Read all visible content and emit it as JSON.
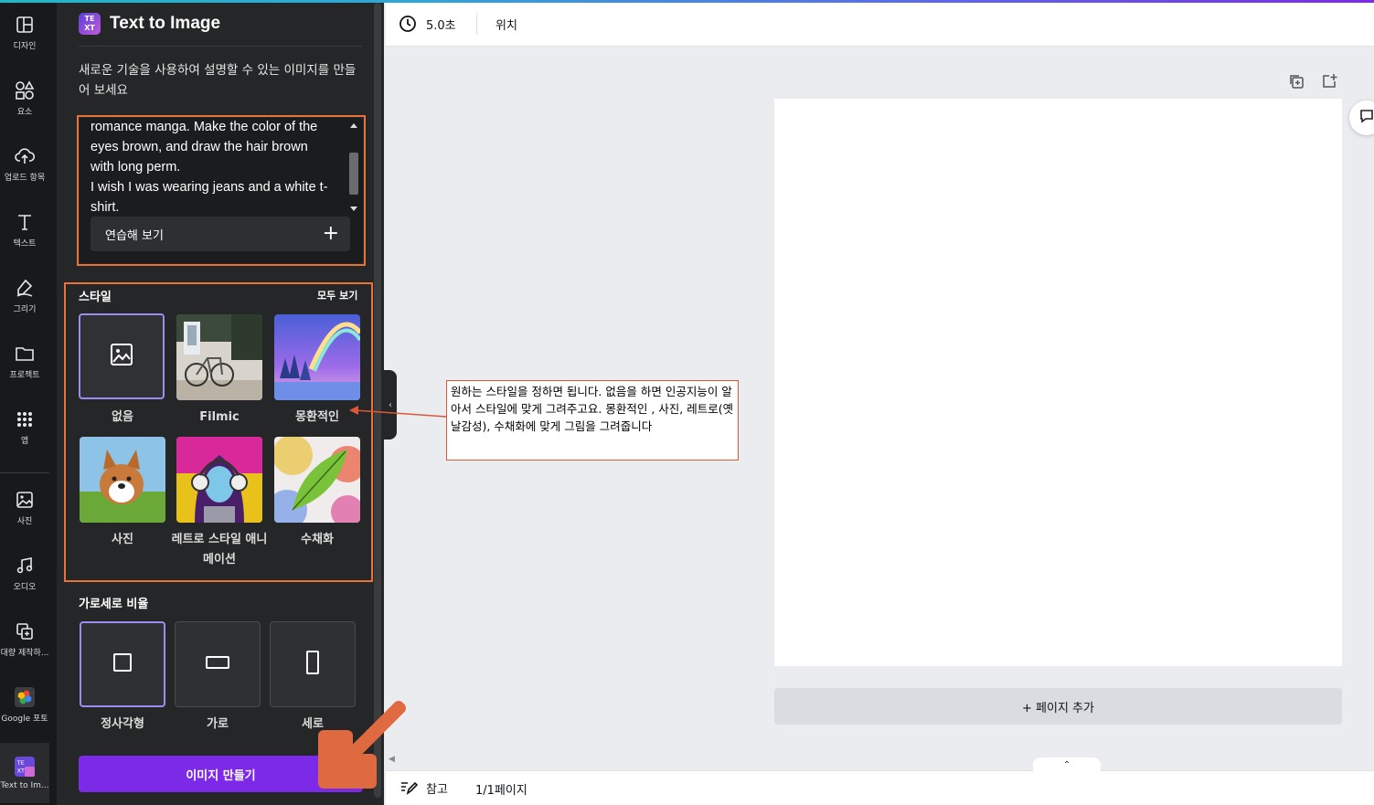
{
  "toolbar": {
    "duration": "5.0초",
    "position_label": "위치"
  },
  "rail": {
    "items": [
      {
        "label": "디자인",
        "icon": "layout-icon"
      },
      {
        "label": "요소",
        "icon": "shapes-icon"
      },
      {
        "label": "업로드 항목",
        "icon": "cloud-upload-icon"
      },
      {
        "label": "텍스트",
        "icon": "text-icon"
      },
      {
        "label": "그리기",
        "icon": "pen-icon"
      },
      {
        "label": "프로젝트",
        "icon": "folder-icon"
      },
      {
        "label": "앱",
        "icon": "apps-grid-icon"
      },
      {
        "label": "사진",
        "icon": "image-icon"
      },
      {
        "label": "오디오",
        "icon": "music-icon"
      },
      {
        "label": "대량 제작하...",
        "icon": "bulk-create-icon"
      },
      {
        "label": "Google 포토",
        "icon": "google-photos-icon"
      },
      {
        "label": "Text to Im...",
        "icon": "text-to-image-icon"
      }
    ]
  },
  "panel": {
    "title": "Text to Image",
    "logo_text": "TE XT 작",
    "description": "새로운 기술을 사용하여 설명할 수 있는 이미지를 만들어 보세요",
    "prompt_text": "romance manga. Make the color of the\neyes brown, and draw the hair brown\nwith long perm.\nI wish I was wearing jeans and a white t-\nshirt.",
    "practice_label": "연습해 보기",
    "style_title": "스타일",
    "see_all": "모두 보기",
    "styles": [
      {
        "label": "없음",
        "selected": true
      },
      {
        "label": "Filmic"
      },
      {
        "label": "몽환적인"
      },
      {
        "label": "사진"
      },
      {
        "label": "레트로 스타일 애니메이션"
      },
      {
        "label": "수채화"
      }
    ],
    "ratio_title": "가로세로 비율",
    "ratios": [
      {
        "label": "정사각형",
        "selected": true
      },
      {
        "label": "가로"
      },
      {
        "label": "세로"
      }
    ],
    "make_button": "이미지 만들기"
  },
  "canvas": {
    "add_page": "+ 페이지 추가"
  },
  "annotation": "원하는 스타일을 정하면 됩니다. 없음을 하면 인공지능이 알아서 스타일에 맞게 그려주고요. 몽환적인 , 사진, 레트로(옛날감성), 수채화에 맞게 그림을 그려줍니다",
  "bottom_bar": {
    "notes": "참고",
    "pages": "1/1페이지"
  },
  "colors": {
    "accent": "#7d2ae8",
    "annotation": "#e8733a",
    "panel_bg": "#252627",
    "rail_bg": "#18191b"
  }
}
